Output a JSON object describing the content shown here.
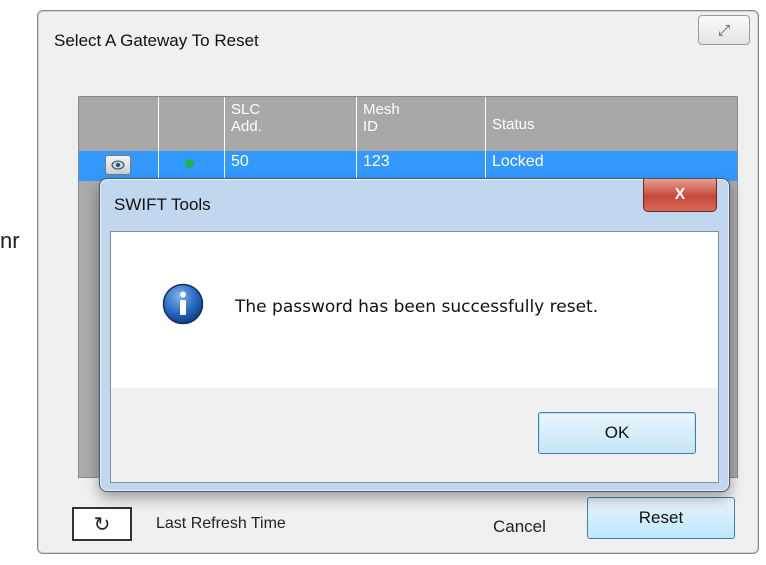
{
  "background": {
    "clipped_text": "nr"
  },
  "gateway_dialog": {
    "title": "Select A Gateway To Reset",
    "close_glyph": "⤢",
    "columns": [
      "",
      "",
      "SLC\nAdd.",
      "Mesh\nID",
      "Status"
    ],
    "column_labels": {
      "slc_line1": "SLC",
      "slc_line2": "Add.",
      "mesh_line1": "Mesh",
      "mesh_line2": "ID",
      "status": "Status"
    },
    "rows": [
      {
        "slc_add": "50",
        "mesh_id": "123",
        "status": "Locked"
      }
    ],
    "refresh_glyph": "↻",
    "last_refresh_label": "Last Refresh Time",
    "cancel_label": "Cancel",
    "reset_label": "Reset"
  },
  "message_box": {
    "title": "SWIFT Tools",
    "close_glyph": "X",
    "message": "The password has been successfully reset.",
    "ok_label": "OK",
    "icon": "info-icon"
  },
  "colors": {
    "selection": "#3399ff",
    "grid_header": "#a8a8a8",
    "close_red": "#c6483a",
    "status_green": "#21b24a"
  }
}
